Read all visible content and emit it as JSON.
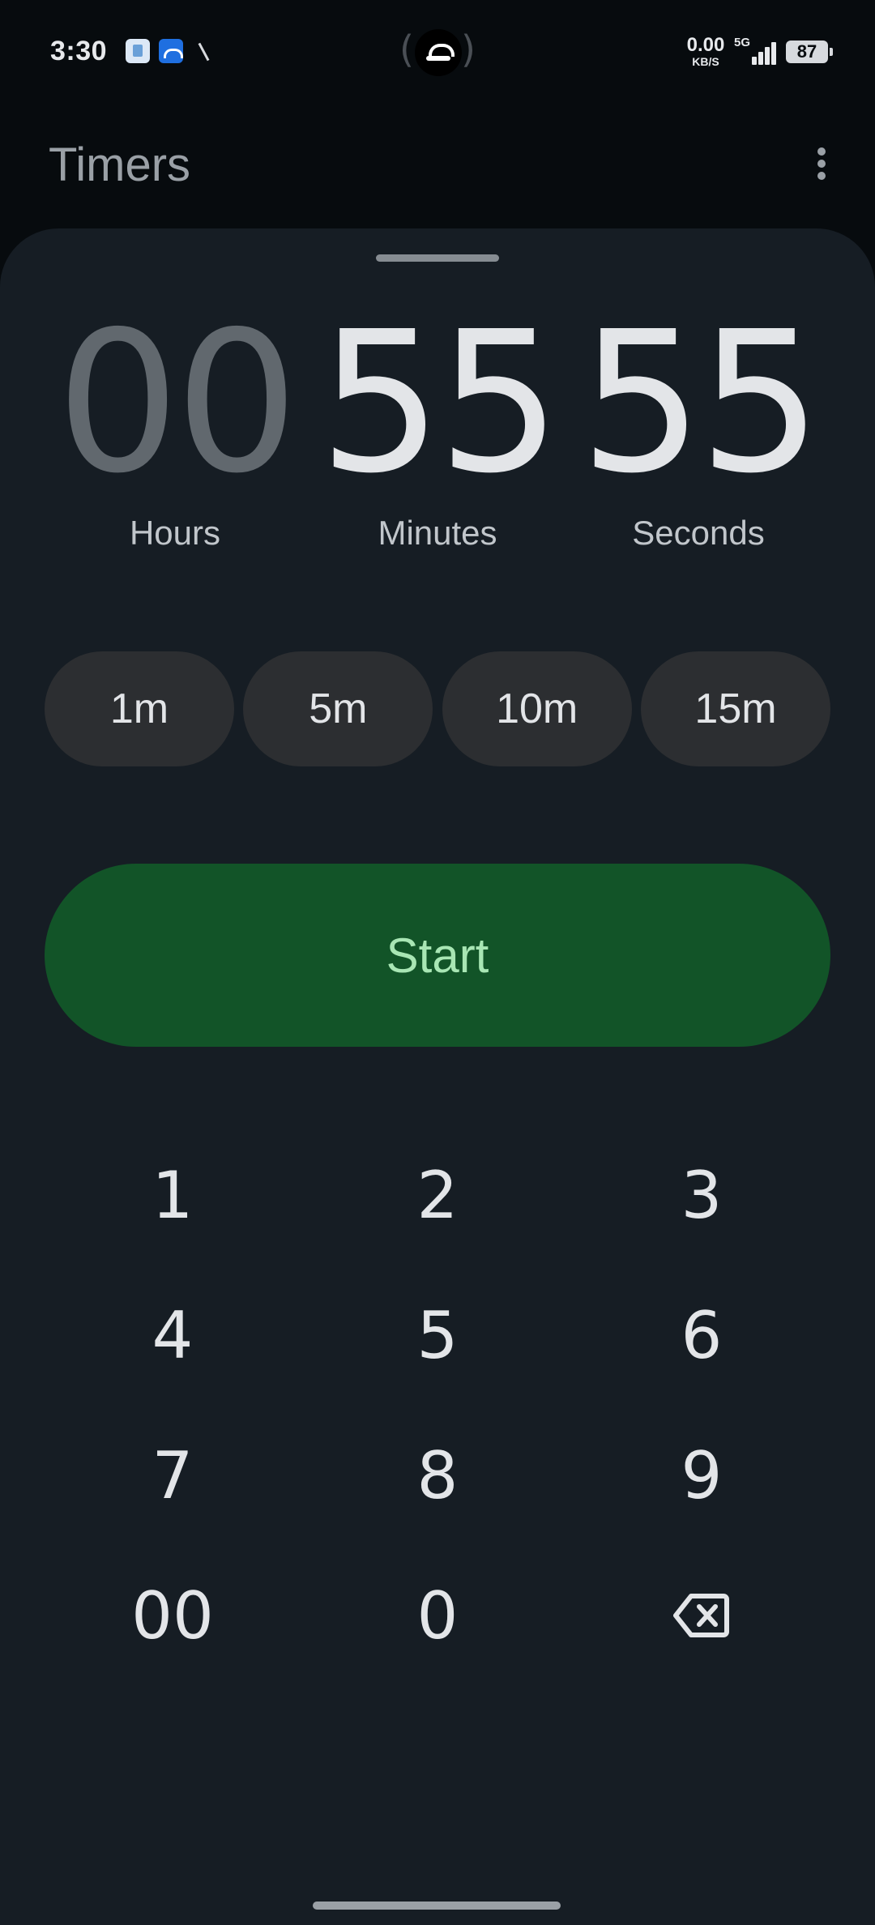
{
  "status_bar": {
    "time": "3:30",
    "net_speed_value": "0.00",
    "net_speed_unit": "KB/S",
    "network_type": "5G",
    "battery_level": "87",
    "notification_icons": [
      "app-notification-icon",
      "wifi-router-app-icon",
      "signal-tool-icon"
    ]
  },
  "app_bar": {
    "title": "Timers",
    "overflow_icon": "more-vert-icon"
  },
  "timer": {
    "hours": "00",
    "minutes": "55",
    "seconds": "55",
    "hours_label": "Hours",
    "minutes_label": "Minutes",
    "seconds_label": "Seconds"
  },
  "presets": [
    "1m",
    "5m",
    "10m",
    "15m"
  ],
  "start_label": "Start",
  "keypad": [
    "1",
    "2",
    "3",
    "4",
    "5",
    "6",
    "7",
    "8",
    "9",
    "00",
    "0"
  ],
  "backspace_icon": "backspace-icon",
  "colors": {
    "background": "#070b0e",
    "sheet": "#161d24",
    "preset_chip": "#2c2e31",
    "start_button": "#125428",
    "start_text": "#a8e6b4",
    "digit_active": "#e3e5e8",
    "digit_inactive": "#61686e"
  }
}
